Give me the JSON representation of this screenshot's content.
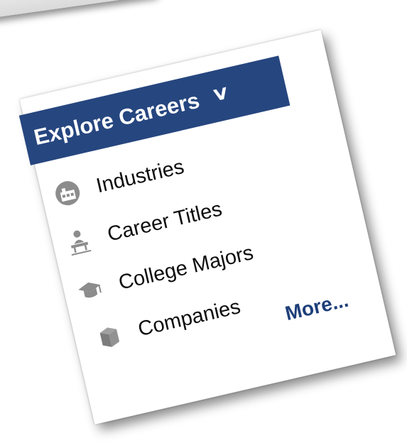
{
  "menu": {
    "title": "Explore Careers",
    "items": [
      {
        "label": "Industries",
        "icon": "industry-icon"
      },
      {
        "label": "Career Titles",
        "icon": "person-at-desk-icon"
      },
      {
        "label": "College Majors",
        "icon": "graduation-cap-icon"
      },
      {
        "label": "Companies",
        "icon": "box-icon"
      }
    ],
    "more_label": "More..."
  },
  "colors": {
    "header_bg": "#26467f",
    "header_text": "#ffffff",
    "item_text": "#0d0d0d",
    "icon_gray": "#8c8c8c",
    "more_link": "#1e3f7a"
  }
}
